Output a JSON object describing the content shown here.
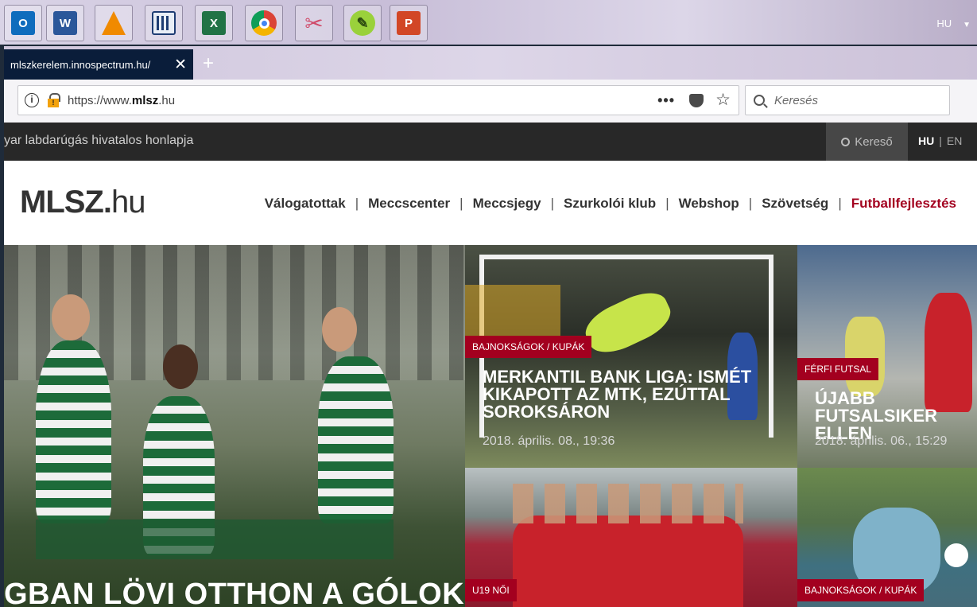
{
  "taskbar": {
    "apps": [
      {
        "name": "outlook-icon",
        "label": "O",
        "color": "#0f6cbd"
      },
      {
        "name": "word-icon",
        "label": "W",
        "color": "#2b579a"
      },
      {
        "name": "vlc-icon",
        "label": "",
        "color": "#f08a00"
      },
      {
        "name": "calculator-icon",
        "label": "",
        "color": "#e8eef6"
      },
      {
        "name": "excel-icon",
        "label": "X",
        "color": "#217346"
      },
      {
        "name": "chrome-icon",
        "label": "",
        "color": "#db4437"
      },
      {
        "name": "snipping-tool-icon",
        "label": "",
        "color": "#d04b6a"
      },
      {
        "name": "greenshot-icon",
        "label": "",
        "color": "#7fbf3a"
      },
      {
        "name": "powerpoint-icon",
        "label": "P",
        "color": "#d24726"
      }
    ],
    "language": "HU"
  },
  "browser": {
    "tab_title": "mlszkerelem.innospectrum.hu/",
    "url_prefix": "https://www.",
    "url_domain": "mlsz",
    "url_suffix": ".hu",
    "search_placeholder": "Keresés"
  },
  "site": {
    "tagline": "yar labdarúgás hivatalos honlapja",
    "search_label": "Kereső",
    "lang_active": "HU",
    "lang_other": "EN",
    "logo_bold": "MLSZ.",
    "logo_light": "hu",
    "nav": [
      "Válogatottak",
      "Meccscenter",
      "Meccsjegy",
      "Szurkolói klub",
      "Webshop",
      "Szövetség",
      "Futballfejlesztés"
    ],
    "accent": "#a3001f"
  },
  "hero": {
    "headline": "GBAN LÖVI OTTHON A GÓLOKAT"
  },
  "cards": [
    {
      "category": "BAJNOKSÁGOK / KUPÁK",
      "title": "MERKANTIL BANK LIGA: ISMÉT KIKAPOTT AZ MTK, EZÚTTAL SOROKSÁRON",
      "date": "2018. április. 08., 19:36"
    },
    {
      "category": "FÉRFI FUTSAL",
      "title": "ÚJABB FUTSALSIKER ELLEN",
      "date": "2018. április. 06., 15:29"
    },
    {
      "category": "U19 NŐI",
      "title": "",
      "date": ""
    },
    {
      "category": "BAJNOKSÁGOK / KUPÁK",
      "title": "",
      "date": ""
    }
  ]
}
